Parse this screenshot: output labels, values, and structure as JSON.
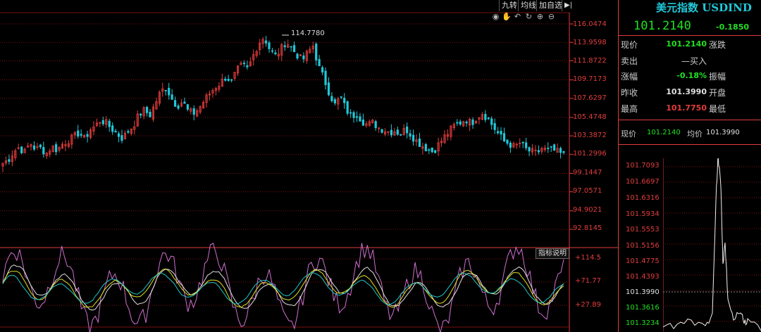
{
  "toolbar": {
    "buttons": [
      "九转",
      "均线",
      "加自选"
    ],
    "arrow_icon": "arrow-right-bar-icon",
    "icons": [
      "eye-icon",
      "hand-icon",
      "undo-icon",
      "refresh-icon",
      "zoom-in-icon",
      "zoom-out-icon"
    ]
  },
  "main_chart": {
    "y_labels": [
      "116.0474",
      "113.9598",
      "111.8722",
      "109.7173",
      "107.6297",
      "105.4748",
      "103.3872",
      "101.2996",
      "99.1447",
      "97.0571",
      "94.9021",
      "92.8145"
    ],
    "peak_label": "114.7780",
    "indicator_button": "指标说明",
    "indicator_labels": [
      "+114.5",
      "+71.77",
      "+27.89"
    ],
    "colors": {
      "up": "#e23c3c",
      "down": "#21c8d8",
      "grid": "#7a1010",
      "ind_white": "#e0e0e0",
      "ind_yellow": "#e0e020",
      "ind_cyan": "#20c8c8",
      "ind_magenta": "#d070d0"
    },
    "close_path": [
      100.3,
      100.7,
      101.6,
      102.1,
      101.5,
      102.6,
      101.9,
      102.0,
      101.4,
      102.2,
      101.8,
      102.5,
      102.9,
      103.2,
      103.8,
      103.0,
      104.1,
      104.5,
      105.2,
      104.8,
      104.2,
      103.6,
      103.1,
      103.9,
      104.6,
      105.8,
      106.3,
      105.7,
      107.1,
      108.4,
      108.9,
      107.6,
      106.8,
      107.3,
      106.2,
      105.9,
      106.5,
      107.4,
      108.2,
      108.9,
      109.4,
      110.1,
      109.5,
      110.8,
      111.4,
      110.9,
      112.5,
      113.9,
      114.6,
      113.2,
      112.4,
      113.1,
      114.1,
      113.3,
      112.6,
      111.9,
      112.8,
      113.6,
      111.2,
      109.8,
      108.2,
      106.9,
      107.8,
      106.4,
      105.6,
      105.9,
      105.1,
      104.6,
      104.9,
      104.3,
      104.1,
      103.8,
      104.0,
      103.6,
      104.2,
      103.5,
      102.8,
      102.3,
      101.9,
      101.6,
      102.4,
      103.2,
      103.9,
      104.6,
      104.9,
      105.3,
      104.8,
      105.5,
      106.0,
      105.4,
      104.5,
      103.6,
      102.8,
      102.5,
      102.1,
      102.6,
      101.9,
      101.6,
      101.4,
      102.0,
      101.7,
      101.8,
      101.5,
      101.2
    ]
  },
  "quote": {
    "title": "美元指数 USDIND",
    "price": "101.2140",
    "change": "-0.1850",
    "rows": [
      {
        "label": "现价",
        "value": "101.2140",
        "color": "#20e020",
        "label2": "涨跌"
      },
      {
        "label": "卖出",
        "value": "—买入",
        "color": "#cccccc",
        "label2": ""
      },
      {
        "label": "涨幅",
        "value": "-0.18%",
        "color": "#20e020",
        "label2": "振幅"
      },
      {
        "label": "昨收",
        "value": "101.3990",
        "color": "#e0e0e0",
        "label2": "开盘"
      },
      {
        "label": "最高",
        "value": "101.7750",
        "color": "#e23c3c",
        "label2": "最低"
      }
    ]
  },
  "mini": {
    "now_label": "现价",
    "now_value": "101.2140",
    "avg_label": "均价",
    "avg_value": "101.3990",
    "y_labels": [
      "101.7093",
      "101.6697",
      "101.6316",
      "101.5934",
      "101.5553",
      "101.5156",
      "101.4775",
      "101.4393",
      "101.3990",
      "101.3616",
      "101.3234"
    ]
  }
}
